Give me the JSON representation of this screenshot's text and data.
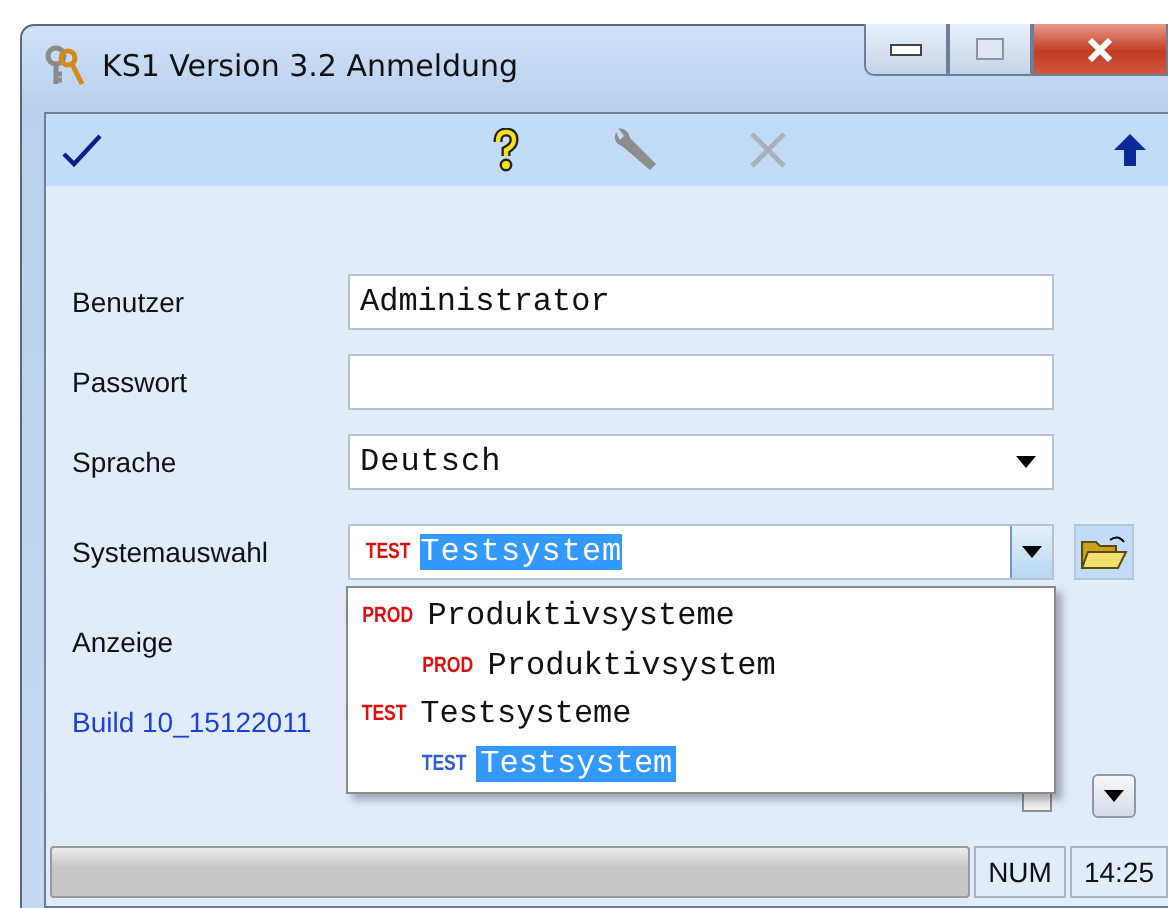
{
  "window": {
    "title": "KS1 Version 3.2 Anmeldung"
  },
  "form": [
    {
      "kind": "text",
      "label": "Benutzer",
      "value": "Administrator"
    },
    {
      "kind": "password",
      "label": "Passwort"
    },
    {
      "kind": "select",
      "label": "Sprache",
      "value": "Deutsch"
    },
    {
      "kind": "system",
      "label": "Systemauswahl",
      "badge": "TEST",
      "value": "Testsystem"
    },
    {
      "kind": "label",
      "label": "Anzeige"
    }
  ],
  "build": "Build 10_15122011",
  "dropdown": {
    "items": [
      {
        "badge": "PROD",
        "label": "Produktivsysteme",
        "selected": false,
        "children": [
          {
            "badge": "PROD",
            "label": "Produktivsystem",
            "selected": false
          }
        ]
      },
      {
        "badge": "TEST",
        "label": "Testsysteme",
        "selected": false,
        "children": [
          {
            "badge": "TEST",
            "label": "Testsystem",
            "selected": true
          }
        ]
      }
    ]
  },
  "sql_checkbox": {
    "checked": false
  },
  "status_bar": {
    "indicator": "NUM",
    "time": "14:25"
  }
}
